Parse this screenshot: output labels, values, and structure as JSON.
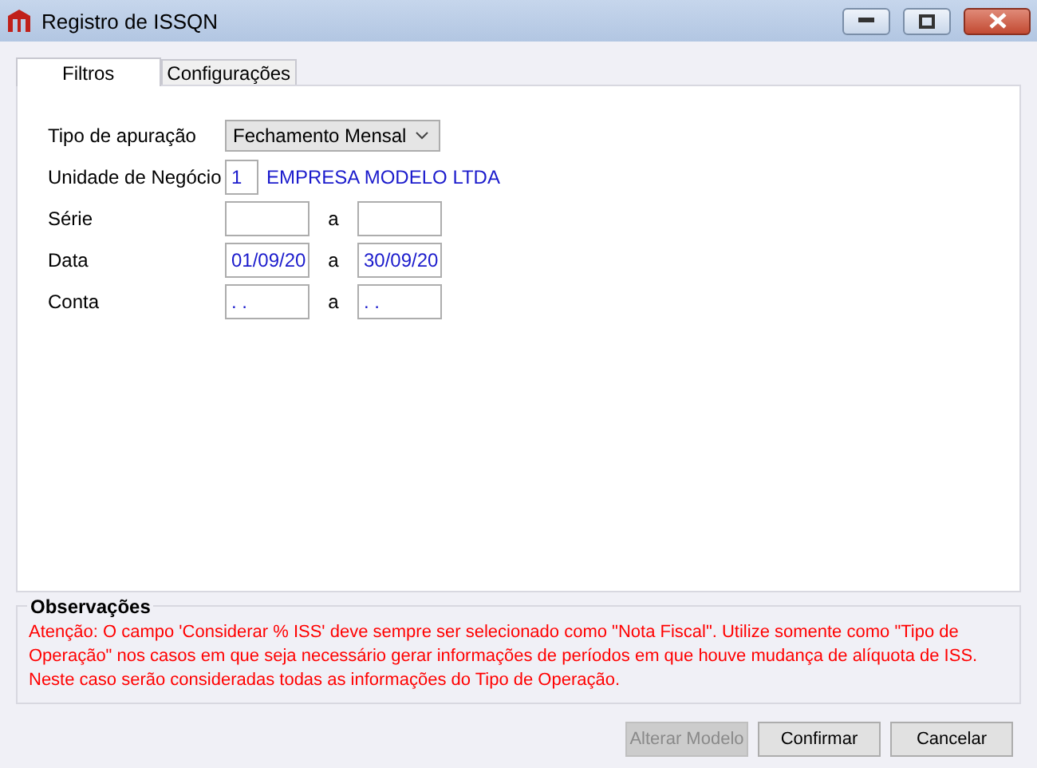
{
  "window": {
    "title": "Registro de ISSQN"
  },
  "tabs": [
    {
      "label": "Filtros",
      "selected": true
    },
    {
      "label": "Configurações",
      "selected": false
    }
  ],
  "fields": [
    {
      "kind": "select",
      "label": "Tipo de apuração",
      "value": "Fechamento Mensal"
    },
    {
      "kind": "lookup",
      "label": "Unidade de Negócio",
      "value": "1",
      "description": "EMPRESA MODELO LTDA"
    },
    {
      "kind": "range",
      "label": "Série",
      "separator": "a"
    },
    {
      "kind": "range",
      "label": "Data",
      "from": "01/09/20",
      "separator": "a",
      "to": "30/09/20"
    },
    {
      "kind": "range",
      "label": "Conta",
      "from": " . .",
      "separator": "a",
      "to": " . ."
    }
  ],
  "observations": {
    "title": "Observações",
    "text": "Atenção: O campo 'Considerar % ISS' deve sempre ser selecionado como \"Nota Fiscal\". Utilize somente como \"Tipo de Operação\" nos casos em que seja necessário gerar informações de períodos em que houve mudança de alíquota de ISS. Neste caso serão consideradas todas as informações do Tipo de Operação."
  },
  "buttons": [
    {
      "label": "Alterar Modelo",
      "disabled": true
    },
    {
      "label": "Confirmar",
      "disabled": false
    },
    {
      "label": "Cancelar",
      "disabled": false
    }
  ]
}
